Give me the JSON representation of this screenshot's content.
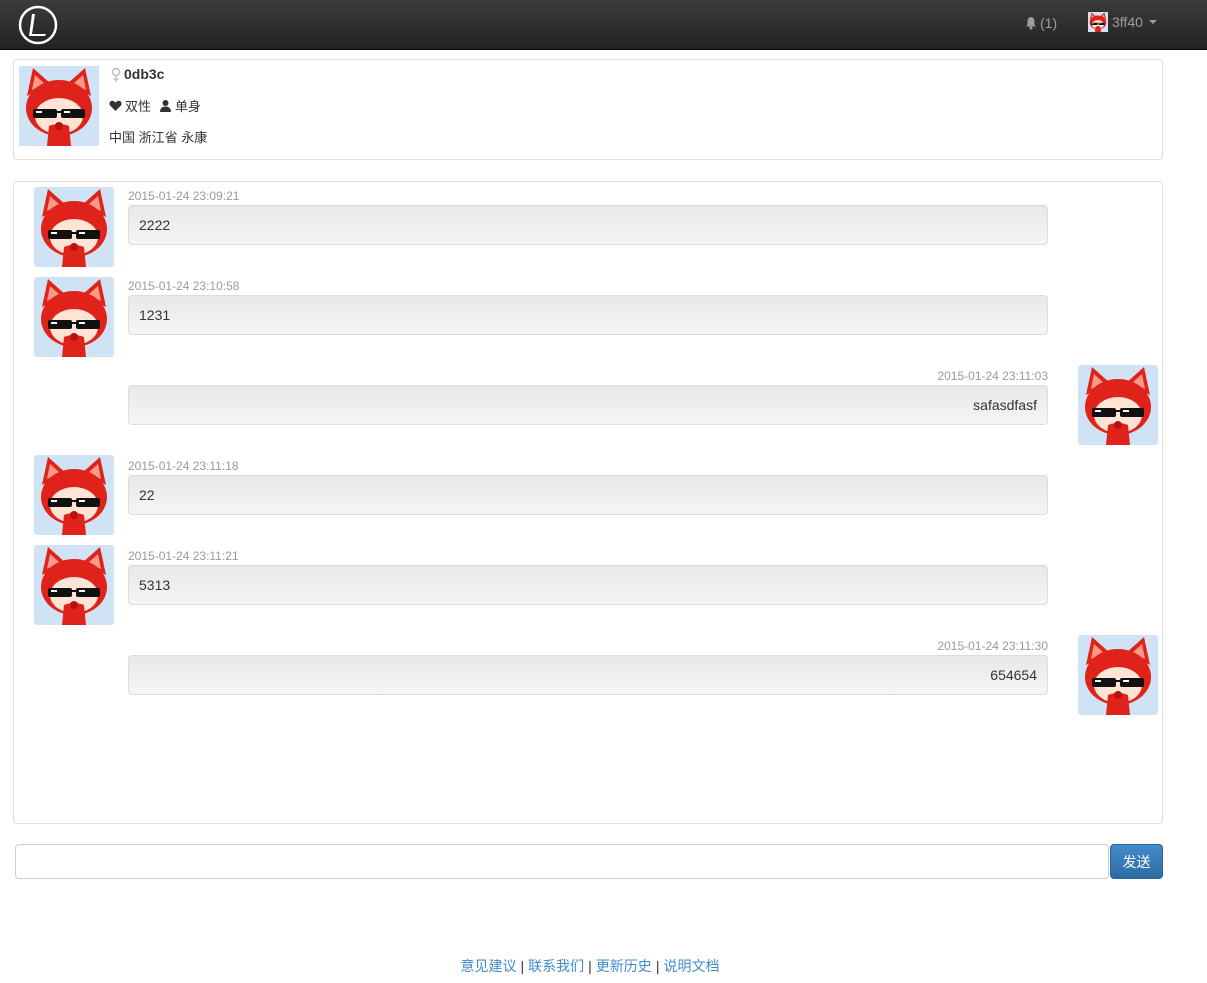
{
  "navbar": {
    "notification_count": "(1)",
    "username": "3ff40"
  },
  "profile": {
    "username": "0db3c",
    "orientation": "双性",
    "relationship_status": "单身",
    "location": "中国 浙江省 永康"
  },
  "messages": [
    {
      "side": "left",
      "time": "2015-01-24 23:09:21",
      "text": "2222"
    },
    {
      "side": "left",
      "time": "2015-01-24 23:10:58",
      "text": "1231"
    },
    {
      "side": "right",
      "time": "2015-01-24 23:11:03",
      "text": "safasdfasf"
    },
    {
      "side": "left",
      "time": "2015-01-24 23:11:18",
      "text": "22"
    },
    {
      "side": "left",
      "time": "2015-01-24 23:11:21",
      "text": "5313"
    },
    {
      "side": "right",
      "time": "2015-01-24 23:11:30",
      "text": "654654"
    }
  ],
  "composer": {
    "input_value": "",
    "send_label": "发送"
  },
  "footer": {
    "links": [
      "意见建议",
      "联系我们",
      "更新历史",
      "说明文档"
    ]
  },
  "colors": {
    "navbar": "#222222",
    "accent": "#428bca",
    "avatar_red": "#e0231a"
  },
  "icons": [
    "logo-icon",
    "bell-icon",
    "caret-down-icon",
    "female-icon",
    "heart-icon",
    "user-icon"
  ]
}
